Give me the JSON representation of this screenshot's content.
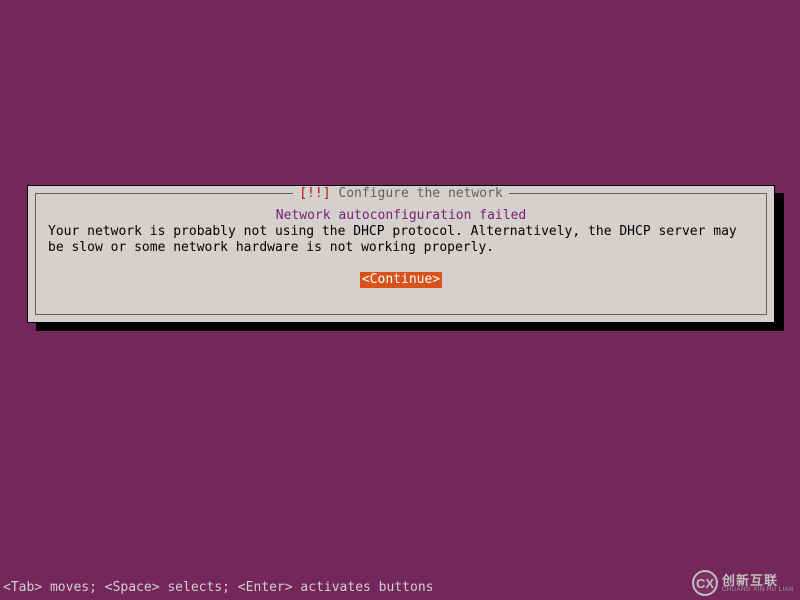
{
  "dialog": {
    "title_alert": "[!!]",
    "title_text": "Configure the network",
    "subtitle": "Network autoconfiguration failed",
    "message": "Your network is probably not using the DHCP protocol. Alternatively, the DHCP server may be slow or some network hardware is not working properly.",
    "continue_label": "<Continue>"
  },
  "helpbar": "<Tab> moves; <Space> selects; <Enter> activates buttons",
  "watermark": {
    "logo_letters": "CX",
    "main": "创新互联",
    "sub": "CHUANG XIN HU LIAN"
  }
}
